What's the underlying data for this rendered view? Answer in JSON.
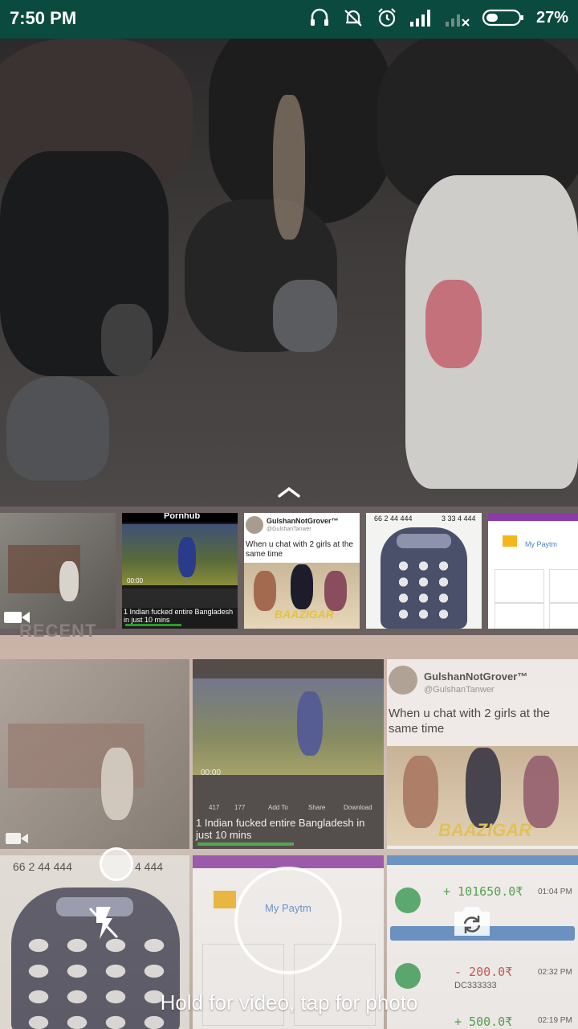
{
  "status_bar": {
    "time": "7:50 PM",
    "battery": "27%",
    "icons": [
      "headset-icon",
      "notifications-muted-icon",
      "alarm-icon",
      "signal-icon",
      "no-signal-icon",
      "battery-icon"
    ]
  },
  "thumbnails": [
    {
      "kind": "video",
      "label": ""
    },
    {
      "kind": "image",
      "brand": "Pornhub",
      "caption": "1 Indian fucked entire Bangladesh in just 10 mins",
      "time": "00:00"
    },
    {
      "kind": "image",
      "name": "GulshanNotGrover™",
      "handle": "@GulshanTanwer",
      "text": "When u chat with 2 girls at the same time",
      "title_art": "BAAZIGAR"
    },
    {
      "kind": "image",
      "digits_left": "66 2 44 444",
      "digits_right": "3 33 4 444"
    },
    {
      "kind": "image",
      "brand": "My Paytm"
    }
  ],
  "recent_label": "RECENT",
  "gallery": {
    "tweet_name": "GulshanNotGrover™",
    "tweet_handle": "@GulshanTanwer",
    "tweet_text": "When u chat with 2 girls at the same time",
    "title_art": "BAAZIGAR",
    "video_caption": "1 Indian fucked entire Bangladesh in just 10 mins",
    "video_time": "00:00",
    "video_actions": [
      "Add To",
      "Share",
      "Download"
    ],
    "video_counts": [
      "417",
      "177"
    ],
    "phone_digits": "66 2 44 444",
    "phone_digits_right": "4 444",
    "paytm_title": "My Paytm",
    "amount_1": "+ 101650.0₹",
    "time_1": "01:04 PM",
    "amount_2": "- 200.0₹",
    "time_2": "02:32 PM",
    "ref_2": "DC333333",
    "amount_3": "+ 500.0₹",
    "time_3": "02:19 PM"
  },
  "camera": {
    "hint": "Hold for video, tap for photo"
  }
}
